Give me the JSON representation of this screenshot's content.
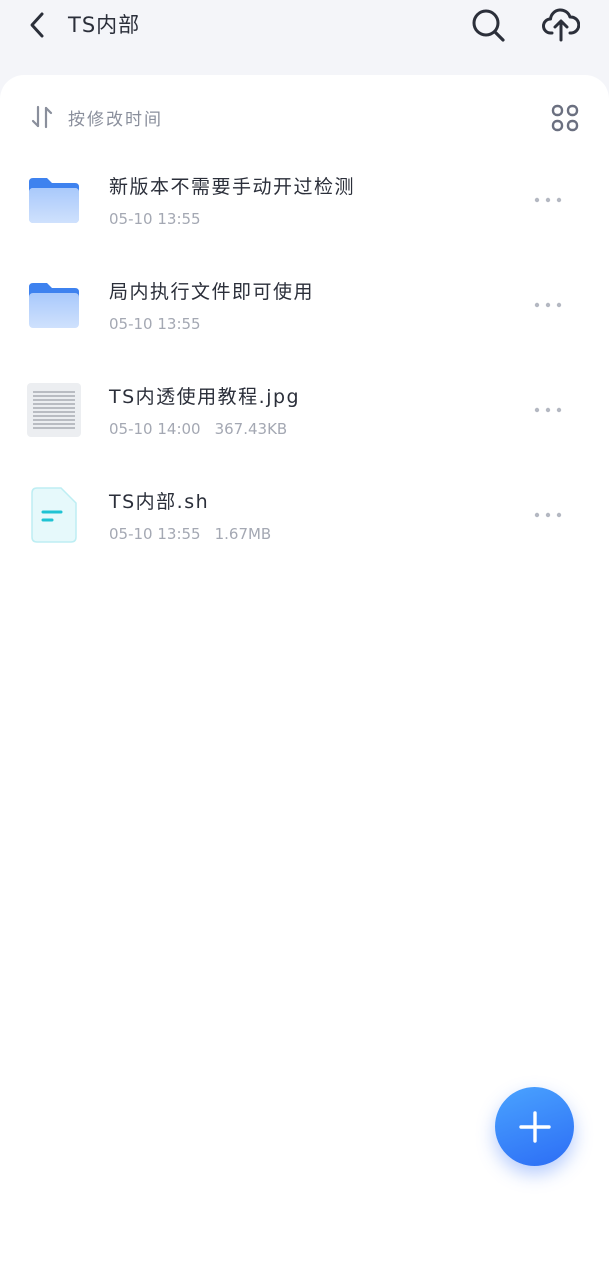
{
  "header": {
    "title": "TS内部",
    "back_icon": "chevron-left-icon",
    "search_icon": "search-icon",
    "upload_icon": "cloud-upload-icon"
  },
  "toolbar": {
    "sort_label": "按修改时间",
    "sort_icon": "sort-icon",
    "view_icon": "grid-view-icon"
  },
  "files": [
    {
      "type": "folder",
      "icon": "folder-icon",
      "name": "新版本不需要手动开过检测",
      "date": "05-10 13:55",
      "size": ""
    },
    {
      "type": "folder",
      "icon": "folder-icon",
      "name": "局内执行文件即可使用",
      "date": "05-10 13:55",
      "size": ""
    },
    {
      "type": "image",
      "icon": "image-thumbnail",
      "name": "TS内透使用教程.jpg",
      "date": "05-10 14:00",
      "size": "367.43KB"
    },
    {
      "type": "script",
      "icon": "script-file-icon",
      "name": "TS内部.sh",
      "date": "05-10 13:55",
      "size": "1.67MB"
    }
  ],
  "fab": {
    "icon": "plus-icon"
  },
  "colors": {
    "accent": "#2f7bf6",
    "folder": "#5b9ef6",
    "script_file": "#1fc3d3",
    "background": "#f4f5f9"
  }
}
